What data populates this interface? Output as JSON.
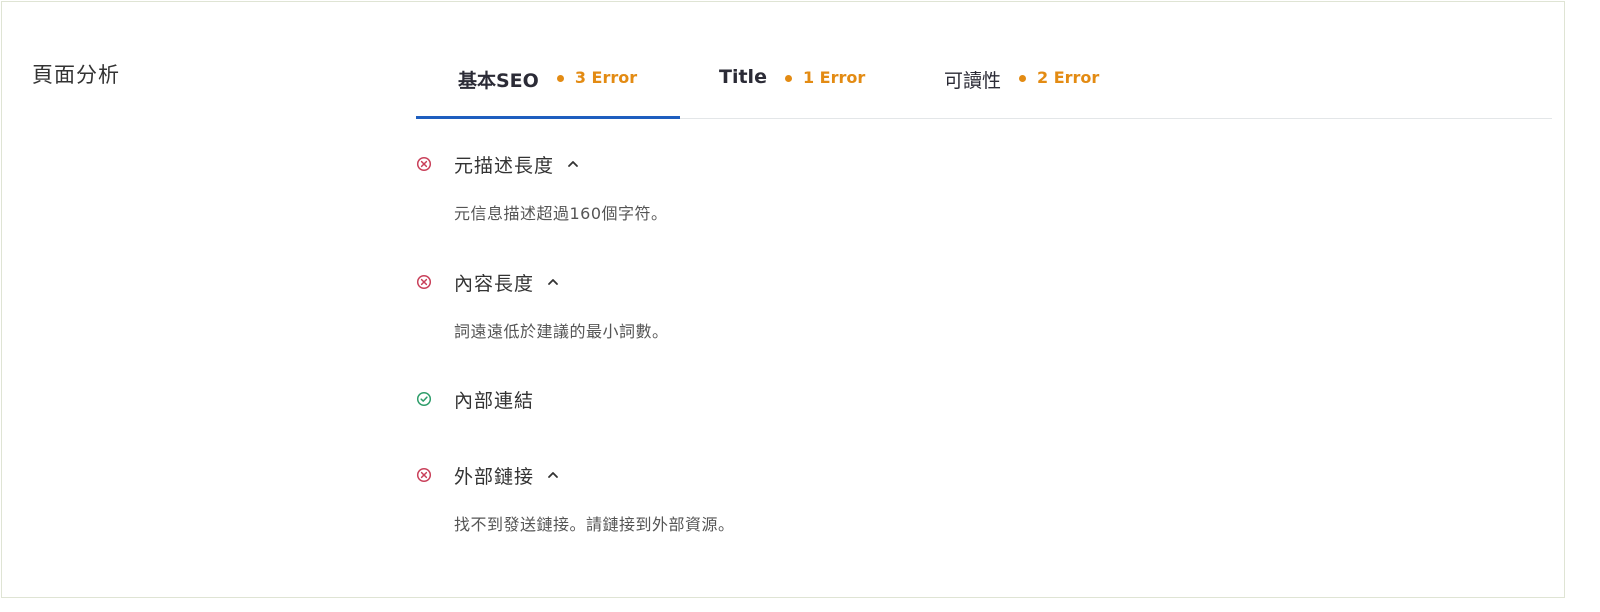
{
  "section": {
    "label": "頁面分析"
  },
  "tabs": [
    {
      "label": "基本SEO",
      "error_text": "3 Error",
      "active": true
    },
    {
      "label": "Title",
      "error_text": "1 Error",
      "active": false
    },
    {
      "label": "可讀性",
      "error_text": "2 Error",
      "active": false
    }
  ],
  "checks": [
    {
      "title": "元描述長度",
      "status": "error",
      "status_icon": "error-circle-icon",
      "expand_icon": "chevron-up-icon",
      "description": "元信息描述超過160個字符。"
    },
    {
      "title": "內容長度",
      "status": "error",
      "status_icon": "error-circle-icon",
      "expand_icon": "chevron-up-icon",
      "description": "詞遠遠低於建議的最小詞數。"
    },
    {
      "title": "內部連結",
      "status": "pass",
      "status_icon": "check-circle-icon",
      "expand_icon": "",
      "description": ""
    },
    {
      "title": "外部鏈接",
      "status": "error",
      "status_icon": "error-circle-icon",
      "expand_icon": "chevron-up-icon",
      "description": "找不到發送鏈接。請鏈接到外部資源。"
    }
  ],
  "colors": {
    "accent": "#1e5ebf",
    "warning": "#e38b13",
    "error": "#c9405a",
    "success": "#2e9d6a",
    "border": "#dfe4d4"
  }
}
